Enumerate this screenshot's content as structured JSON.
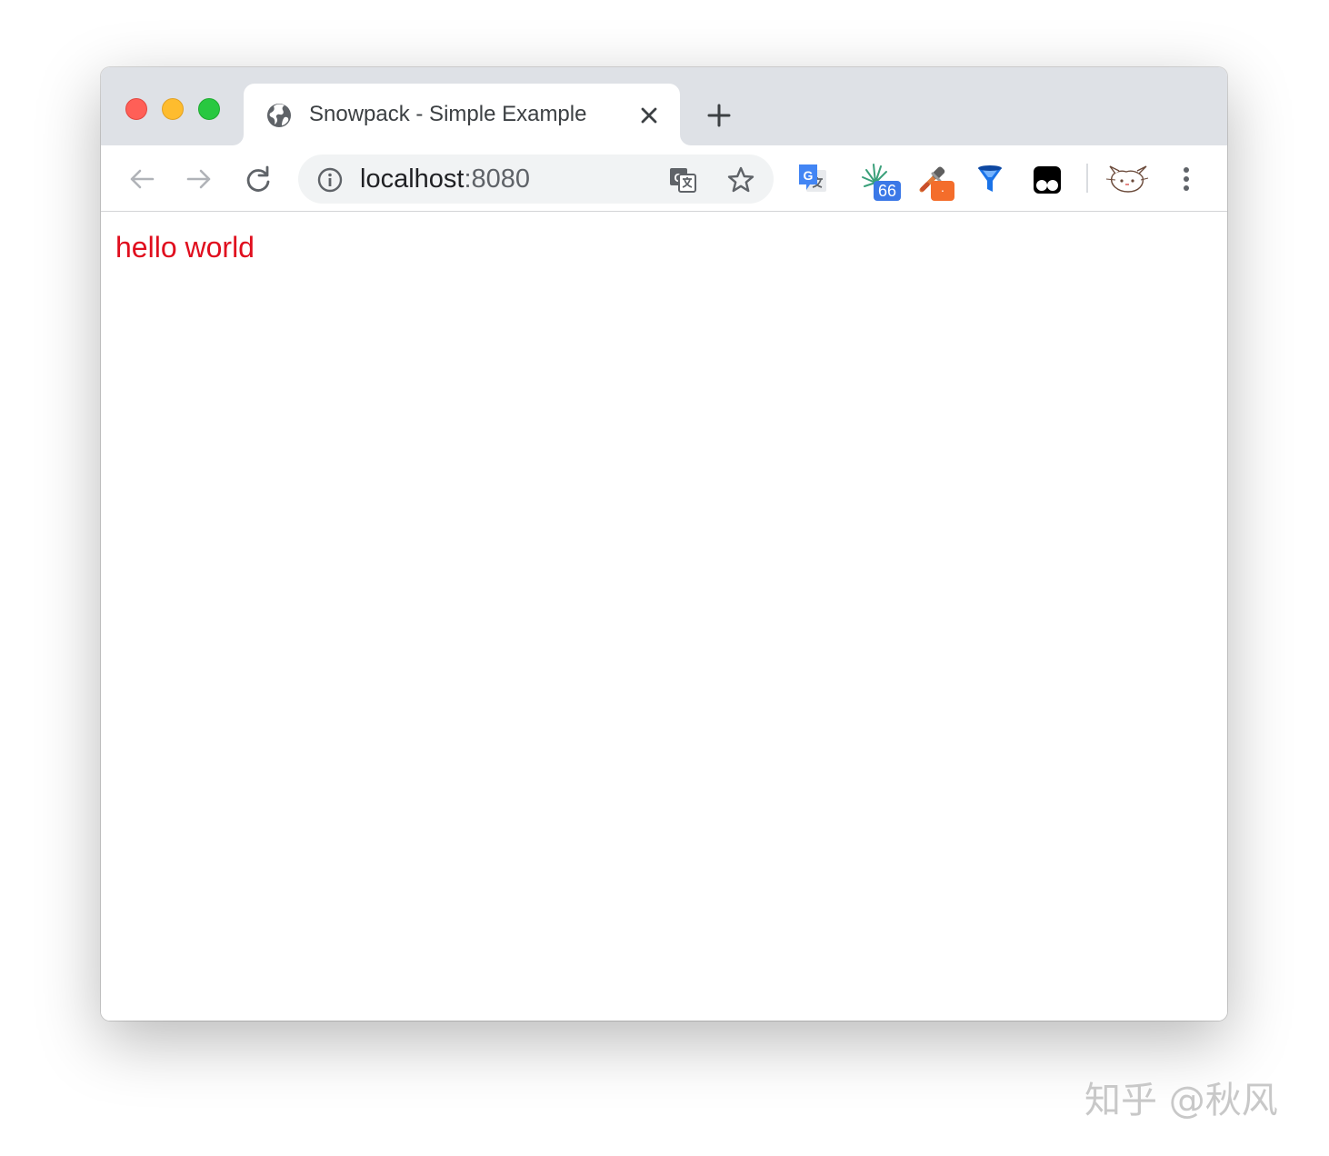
{
  "tab": {
    "title": "Snowpack - Simple Example",
    "favicon_icon": "globe-icon"
  },
  "toolbar": {
    "url_host": "localhost",
    "url_port": ":8080",
    "back_icon": "back-arrow-icon",
    "forward_icon": "forward-arrow-icon",
    "reload_icon": "reload-icon",
    "site_info_icon": "info-icon",
    "translate_icon": "translate-icon",
    "bookmark_icon": "star-icon",
    "menu_icon": "kebab-menu-icon"
  },
  "extensions": [
    {
      "name": "google-translate-extension",
      "icon": "google-translate-icon",
      "badge": ""
    },
    {
      "name": "sparkle-extension",
      "icon": "sparkle-icon",
      "badge": "66"
    },
    {
      "name": "eyedropper-extension",
      "icon": "eyedropper-icon",
      "badge": "·"
    },
    {
      "name": "funnel-extension",
      "icon": "funnel-icon",
      "badge": ""
    },
    {
      "name": "tampermonkey-extension",
      "icon": "tampermonkey-icon",
      "badge": ""
    },
    {
      "name": "cat-extension",
      "icon": "cat-avatar-icon",
      "badge": ""
    }
  ],
  "page": {
    "text": "hello world"
  },
  "watermark": "知乎 @秋风",
  "colors": {
    "hello_text": "#e00e1e",
    "titlebar": "#dee1e6",
    "omnibox": "#f1f3f4",
    "badge_blue": "#3b78e7",
    "badge_orange": "#f46d2b"
  }
}
